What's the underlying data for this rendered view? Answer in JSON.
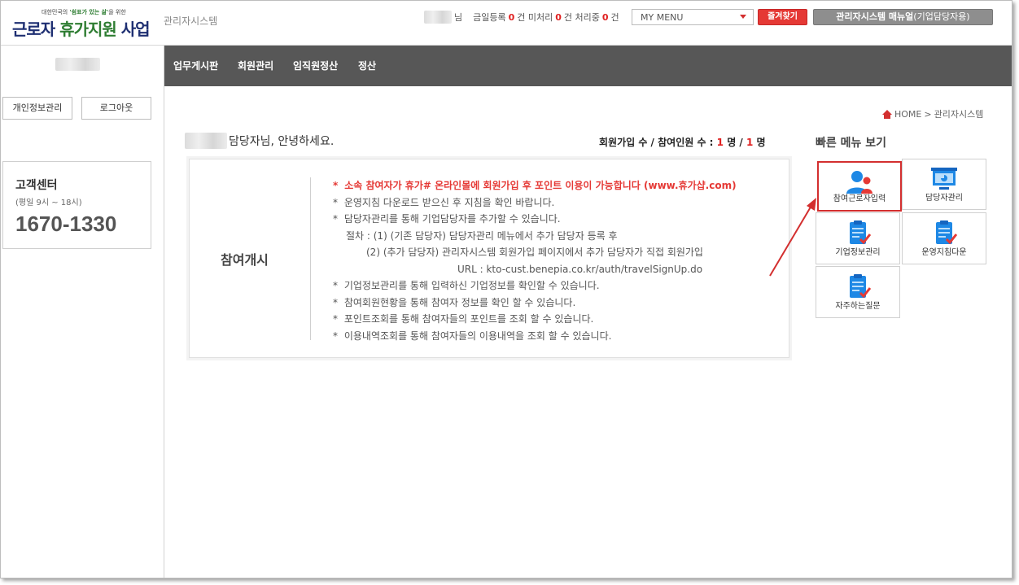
{
  "header": {
    "logo_slogan_prefix": "대한민국의",
    "logo_slogan_highlight": "'쉼표가 있는 삶'",
    "logo_slogan_suffix": "을 위한",
    "logo_title_part1": "근로자 ",
    "logo_title_part2": "휴가지원",
    "logo_title_part3": " 사업",
    "admin_label": "관리자시스템",
    "user_suffix": "님",
    "today_label": "금일등록",
    "today_count": "0",
    "unprocessed_label": "건 미처리",
    "unprocessed_count": "0",
    "processing_label": "건 처리중",
    "processing_count": "0",
    "count_unit": "건",
    "mymenu_value": "MY MENU",
    "favorites_label": "즐겨찾기",
    "manual_label_bold": "관리자시스템 매뉴얼",
    "manual_label_suffix": "(기업담당자용)"
  },
  "sidebar": {
    "profile_button": "개인정보관리",
    "logout_button": "로그아웃",
    "cs_title": "고객센터",
    "cs_hours": "(평일 9시 ~ 18시)",
    "cs_phone": "1670-1330"
  },
  "nav": {
    "items": [
      "업무게시판",
      "회원관리",
      "임직원정산",
      "정산"
    ]
  },
  "breadcrumb": {
    "home": "HOME",
    "separator": ">",
    "current": "관리자시스템"
  },
  "greeting": {
    "text": "담당자님, 안녕하세요."
  },
  "stats": {
    "label": "회원가입 수 / 참여인원 수 : ",
    "joined": "1",
    "unit1": " 명 / ",
    "participants": "1",
    "unit2": " 명"
  },
  "main": {
    "title": "참여개시",
    "notices": [
      "소속 참여자가 휴가# 온라인몰에 회원가입 후 포인트 이용이 가능합니다 (www.휴가샵.com)",
      "운영지침 다운로드 받으신 후 지침을 확인 바랍니다.",
      "담당자관리를 통해 기업담당자를 추가할 수 있습니다.",
      "절차 : (1) (기존 담당자) 담당자관리 메뉴에서 추가 담당자 등록 후",
      "(2) (추가 담당자) 관리자시스템 회원가입 페이지에서 추가 담당자가 직접 회원가입",
      "URL : kto-cust.benepia.co.kr/auth/travelSignUp.do",
      "기업정보관리를 통해 입력하신 기업정보를 확인할 수 있습니다.",
      "참여회원현황을 통해 참여자 정보를 확인 할 수 있습니다.",
      "포인트조회를 통해 참여자들의 포인트를 조회 할 수 있습니다.",
      "이용내역조회를 통해 참여자들의 이용내역을 조회 할 수 있습니다."
    ],
    "star": "*"
  },
  "quick": {
    "title": "빠른 메뉴 보기",
    "items": [
      {
        "label": "참여근로자입력",
        "icon": "users-icon"
      },
      {
        "label": "담당자관리",
        "icon": "presentation-icon"
      },
      {
        "label": "기업정보관리",
        "icon": "clipboard-check-icon"
      },
      {
        "label": "운영지침다운",
        "icon": "clipboard-check-icon"
      },
      {
        "label": "자주하는질문",
        "icon": "clipboard-check-icon"
      }
    ]
  },
  "colors": {
    "accent_red": "#e53935",
    "nav_bg": "#575757",
    "logo_blue": "#1e2f72",
    "icon_blue": "#1e88e5"
  }
}
